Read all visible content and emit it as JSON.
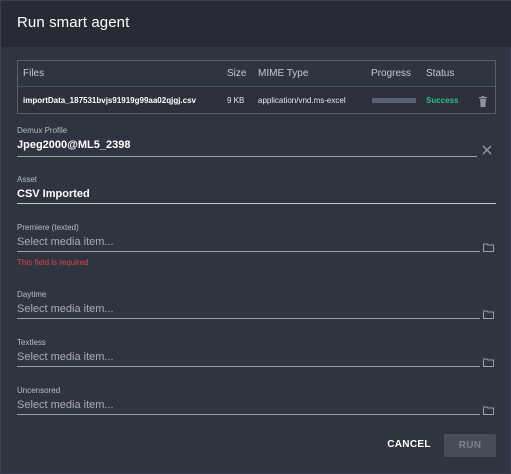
{
  "dialog": {
    "title": "Run smart agent"
  },
  "files_table": {
    "columns": [
      "Files",
      "Size",
      "MIME Type",
      "Progress",
      "Status"
    ],
    "rows": [
      {
        "file": "importData_187531bvjs91919g99aa02qjgj.csv",
        "size": "9 KB",
        "mime": "application/vnd.ms-excel",
        "progress": 1.0,
        "status": "Success"
      }
    ]
  },
  "fields": {
    "demux": {
      "label": "Demux Profile",
      "value": "Jpeg2000@ML5_2398"
    },
    "asset": {
      "label": "Asset",
      "value": "CSV Imported"
    },
    "premiere": {
      "label": "Premiere (texted)",
      "placeholder": "Select media item...",
      "error": "This field is required"
    },
    "daytime": {
      "label": "Daytime",
      "placeholder": "Select media item..."
    },
    "textless": {
      "label": "Textless",
      "placeholder": "Select media item..."
    },
    "uncensored": {
      "label": "Uncensored",
      "placeholder": "Select media item..."
    }
  },
  "footer": {
    "cancel_label": "CANCEL",
    "run_label": "RUN"
  },
  "colors": {
    "success": "#2fbf8a",
    "error": "#e0453f",
    "background": "#2f3441",
    "header": "#272b36"
  },
  "icons": {
    "clear": "close-icon",
    "folder": "folder-icon",
    "delete": "trash-icon"
  }
}
